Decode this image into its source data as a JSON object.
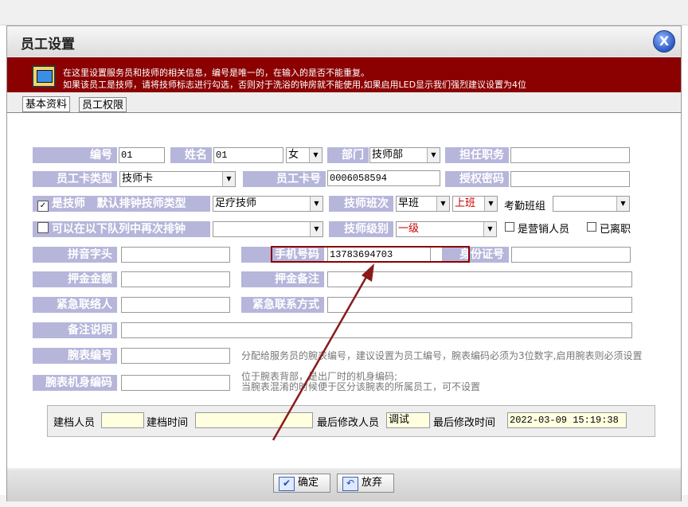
{
  "dialog": {
    "title": "员工设置",
    "close_label": "X"
  },
  "banner": {
    "line1": "在这里设置服务员和技师的相关信息，编号是唯一的，在输入的是否不能重复。",
    "line2": "如果该员工是技师，请将技师标志进行勾选，否则对于洗浴的钟房就不能使用,如果启用LED显示我们强烈建议设置为4位"
  },
  "tabs": [
    {
      "label": "基本资料"
    },
    {
      "label": "员工权限"
    }
  ],
  "form": {
    "id_label": "编号",
    "id_value": "01",
    "name_label": "姓名",
    "name_value": "01",
    "gender_value": "女",
    "dept_label": "部门",
    "dept_value": "技师部",
    "duty_label": "担任职务",
    "duty_value": "",
    "cardtype_label": "员工卡类型",
    "cardtype_value": "技师卡",
    "cardno_label": "员工卡号",
    "cardno_value": "0006058594",
    "authcode_label": "授权密码",
    "authcode_value": "",
    "is_tech_label": "是技师",
    "is_tech_checked": true,
    "default_clock_label": "默认排钟技师类型",
    "default_clock_value": "足疗技师",
    "shift_label": "技师班次",
    "shift_value": "早班",
    "work_status_value": "上班",
    "attendance_label": "考勤班组",
    "attendance_value": "",
    "requeue_label": "可以在以下队列中再次排钟",
    "requeue_checked": false,
    "requeue_value": "",
    "level_label": "技师级别",
    "level_value": "一级",
    "sales_label": "是营销人员",
    "sales_checked": false,
    "resigned_label": "已离职",
    "resigned_checked": false,
    "pinyin_label": "拼音字头",
    "pinyin_value": "",
    "phone_label": "手机号码",
    "phone_value": "13783694703",
    "idcard_label": "身份证号",
    "idcard_value": "",
    "deposit_label": "押金金额",
    "deposit_value": "",
    "deposit_note_label": "押金备注",
    "deposit_note_value": "",
    "emergency_contact_label": "紧急联络人",
    "emergency_contact_value": "",
    "emergency_phone_label": "紧急联系方式",
    "emergency_phone_value": "",
    "remark_label": "备注说明",
    "remark_value": "",
    "watch_no_label": "腕表编号",
    "watch_no_value": "",
    "watch_no_hint": "分配给服务员的腕表编号，建议设置为员工编号，腕表编码必须为3位数字,启用腕表则必须设置",
    "watch_code_label": "腕表机身编码",
    "watch_code_value": "",
    "watch_code_hint1": "位于腕表背部，是出厂时的机身编码;",
    "watch_code_hint2": "当腕表混淆的时候便于区分该腕表的所属员工，可不设置"
  },
  "record": {
    "creator_label": "建档人员",
    "creator_value": "",
    "created_label": "建档时间",
    "created_value": "",
    "modifier_label": "最后修改人员",
    "modifier_value": "调试",
    "modified_label": "最后修改时间",
    "modified_value": "2022-03-09 15:19:38"
  },
  "buttons": {
    "ok_label": "确定",
    "cancel_label": "放弃"
  },
  "icons": {
    "check": "check-icon",
    "undo": "undo-icon",
    "close": "close-icon"
  },
  "colors": {
    "banner_bg": "#8b0000",
    "label_bg": "#b6b6db",
    "work_status": "#cc0000",
    "highlight": "#8b0000"
  }
}
